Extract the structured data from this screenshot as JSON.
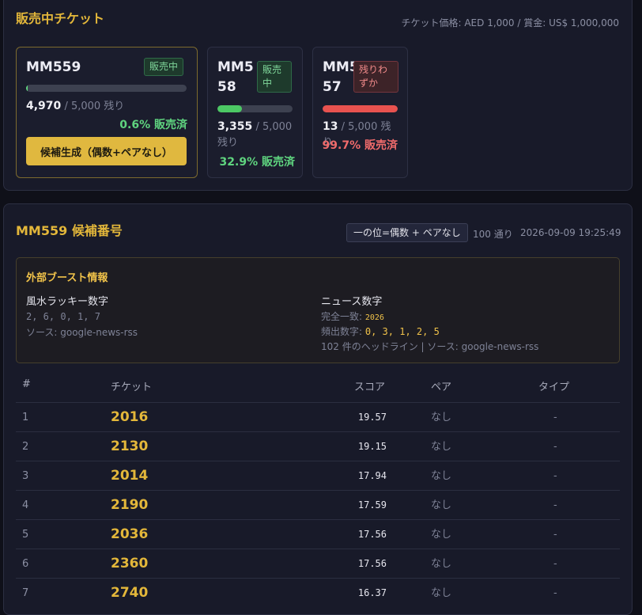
{
  "sales": {
    "title": "販売中チケット",
    "price_info": "チケット価格: AED 1,000 / 賞金: US$ 1,000,000",
    "tickets": [
      {
        "name": "MM559",
        "badge": "販売中",
        "badge_color": "#7fd69a",
        "remaining": "4,970",
        "total": "/ 5,000 残り",
        "sold_text": "0.6% 販売済",
        "sold_fraction": 0.006,
        "bar_color": "#5fd47f"
      },
      {
        "name": "MM558",
        "badge": "販売中",
        "badge_color": "#7fd69a",
        "remaining": "3,355",
        "total": "/ 5,000 残り",
        "sold_text": "32.9% 販売済",
        "sold_fraction": 0.329,
        "bar_color": "#4cc864"
      },
      {
        "name": "MM557",
        "badge": "残りわずか",
        "badge_color": "#f08a8a",
        "remaining": "13",
        "total": "/ 5,000 残り",
        "sold_text": "99.7% 販売済",
        "sold_fraction": 0.997,
        "bar_color": "#e8524f"
      }
    ],
    "generate_button": "候補生成（偶数+ペアなし）"
  },
  "candidates": {
    "title": "MM559 候補番号",
    "filter": "一の位=偶数 + ペアなし",
    "count": "100 通り",
    "timestamp": "2026-09-09 19:25:49",
    "boost": {
      "title": "外部ブースト情報",
      "fengshui_label": "風水ラッキー数字",
      "fengshui_digits": "2, 6, 0, 1, 7",
      "fengshui_source": "ソース: google-news-rss",
      "news_label": "ニュース数字",
      "exact_label": "完全一致:",
      "exact_value": "2026",
      "freq_label": "頻出数字:",
      "freq_value": "0, 3, 1, 2, 5",
      "headline_info": "102 件のヘッドライン | ソース: google-news-rss"
    },
    "columns": {
      "idx": "#",
      "ticket": "チケット",
      "score": "スコア",
      "pair": "ペア",
      "type": "タイプ"
    },
    "rows": [
      {
        "idx": "1",
        "ticket": "2016",
        "score": "19.57",
        "pair": "なし",
        "type": "-"
      },
      {
        "idx": "2",
        "ticket": "2130",
        "score": "19.15",
        "pair": "なし",
        "type": "-"
      },
      {
        "idx": "3",
        "ticket": "2014",
        "score": "17.94",
        "pair": "なし",
        "type": "-"
      },
      {
        "idx": "4",
        "ticket": "2190",
        "score": "17.59",
        "pair": "なし",
        "type": "-"
      },
      {
        "idx": "5",
        "ticket": "2036",
        "score": "17.56",
        "pair": "なし",
        "type": "-"
      },
      {
        "idx": "6",
        "ticket": "2360",
        "score": "17.56",
        "pair": "なし",
        "type": "-"
      },
      {
        "idx": "7",
        "ticket": "2740",
        "score": "16.37",
        "pair": "なし",
        "type": "-"
      }
    ]
  }
}
